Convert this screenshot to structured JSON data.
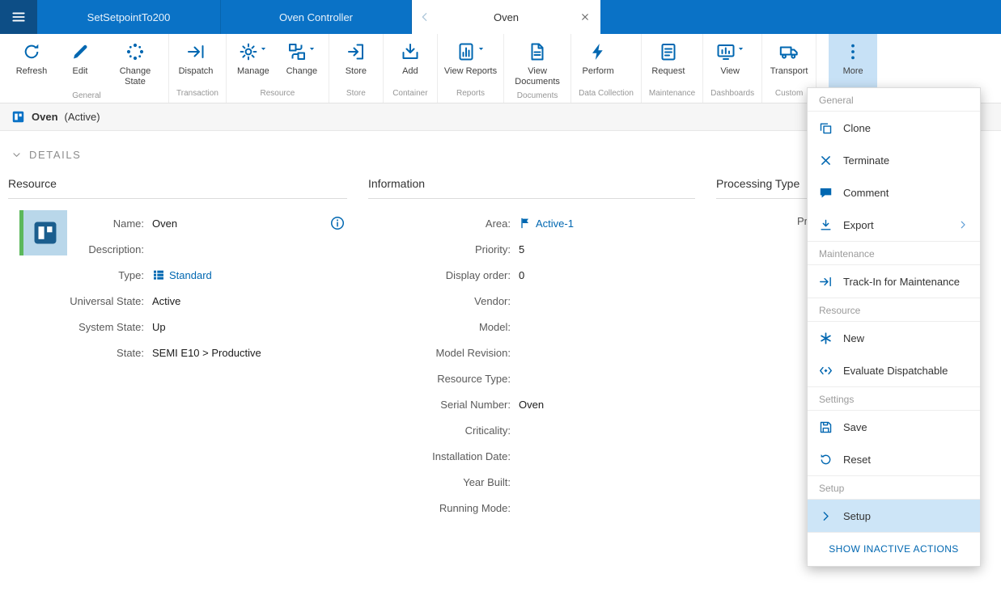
{
  "topbar": {
    "tabs": [
      {
        "label": "SetSetpointTo200"
      },
      {
        "label": "Oven Controller"
      },
      {
        "label": "Oven"
      }
    ]
  },
  "ribbon": {
    "groups": [
      {
        "name": "General",
        "buttons": [
          {
            "label": "Refresh"
          },
          {
            "label": "Edit"
          },
          {
            "label": "Change State"
          }
        ]
      },
      {
        "name": "Transaction",
        "buttons": [
          {
            "label": "Dispatch"
          }
        ]
      },
      {
        "name": "Resource",
        "buttons": [
          {
            "label": "Manage"
          },
          {
            "label": "Change"
          }
        ]
      },
      {
        "name": "Store",
        "buttons": [
          {
            "label": "Store"
          }
        ]
      },
      {
        "name": "Container",
        "buttons": [
          {
            "label": "Add"
          }
        ]
      },
      {
        "name": "Reports",
        "buttons": [
          {
            "label": "View Reports"
          }
        ]
      },
      {
        "name": "Documents",
        "buttons": [
          {
            "label": "View Documents"
          }
        ]
      },
      {
        "name": "Data Collection",
        "buttons": [
          {
            "label": "Perform"
          }
        ]
      },
      {
        "name": "Maintenance",
        "buttons": [
          {
            "label": "Request"
          }
        ]
      },
      {
        "name": "Dashboards",
        "buttons": [
          {
            "label": "View"
          }
        ]
      },
      {
        "name": "Custom",
        "buttons": [
          {
            "label": "Transport"
          }
        ]
      }
    ],
    "more_label": "More"
  },
  "breadcrumb": {
    "title": "Oven",
    "status": "(Active)"
  },
  "details": {
    "label": "DETAILS"
  },
  "resource": {
    "title": "Resource",
    "fields": [
      {
        "label": "Name:",
        "value": "Oven"
      },
      {
        "label": "Description:",
        "value": ""
      },
      {
        "label": "Type:",
        "value": "Standard"
      },
      {
        "label": "Universal State:",
        "value": "Active"
      },
      {
        "label": "System State:",
        "value": "Up"
      },
      {
        "label": "State:",
        "value": "SEMI E10 > Productive"
      }
    ]
  },
  "information": {
    "title": "Information",
    "fields": [
      {
        "label": "Area:",
        "value": "Active-1"
      },
      {
        "label": "Priority:",
        "value": "5"
      },
      {
        "label": "Display order:",
        "value": "0"
      },
      {
        "label": "Vendor:",
        "value": ""
      },
      {
        "label": "Model:",
        "value": ""
      },
      {
        "label": "Model Revision:",
        "value": ""
      },
      {
        "label": "Resource Type:",
        "value": ""
      },
      {
        "label": "Serial Number:",
        "value": "Oven"
      },
      {
        "label": "Criticality:",
        "value": ""
      },
      {
        "label": "Installation Date:",
        "value": ""
      },
      {
        "label": "Year Built:",
        "value": ""
      },
      {
        "label": "Running Mode:",
        "value": ""
      }
    ]
  },
  "processing": {
    "title": "Processing Type",
    "truncated_label": "Pro"
  },
  "menu": {
    "sections": [
      {
        "header": "General",
        "items": [
          {
            "label": "Clone"
          },
          {
            "label": "Terminate"
          },
          {
            "label": "Comment"
          },
          {
            "label": "Export"
          }
        ]
      },
      {
        "header": "Maintenance",
        "items": [
          {
            "label": "Track-In for Maintenance"
          }
        ]
      },
      {
        "header": "Resource",
        "items": [
          {
            "label": "New"
          },
          {
            "label": "Evaluate Dispatchable"
          }
        ]
      },
      {
        "header": "Settings",
        "items": [
          {
            "label": "Save"
          },
          {
            "label": "Reset"
          }
        ]
      },
      {
        "header": "Setup",
        "items": [
          {
            "label": "Setup"
          }
        ]
      }
    ],
    "footer": "SHOW INACTIVE ACTIONS"
  },
  "colors": {
    "brand_blue": "#0a72c6",
    "icon_blue": "#0067b1",
    "menu_highlight": "#cde5f7",
    "status_green": "#5cb85c"
  }
}
